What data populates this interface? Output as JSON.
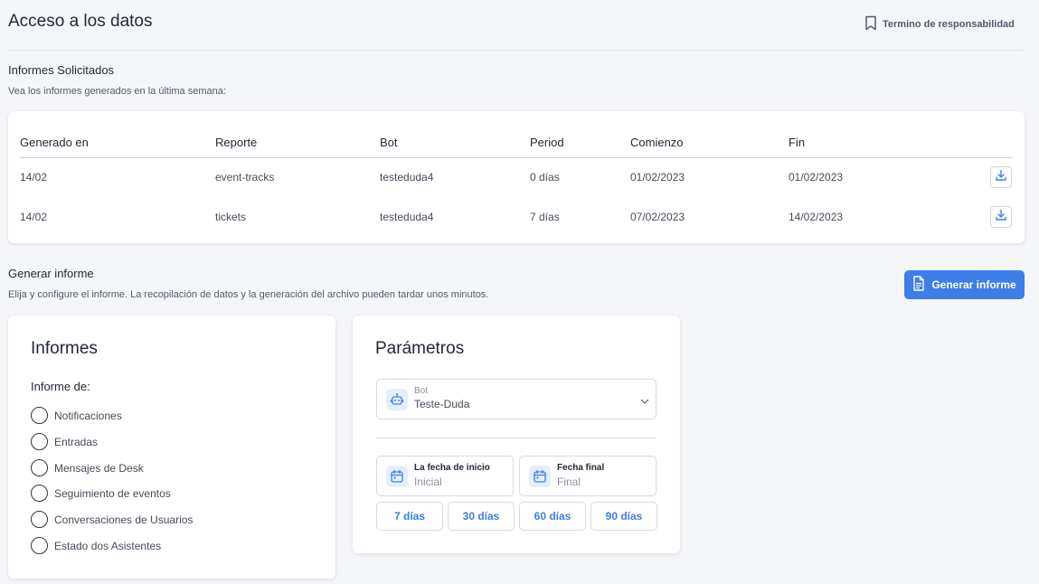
{
  "header": {
    "title": "Acceso a los datos",
    "terms_label": "Termino de responsabilidad"
  },
  "reports": {
    "title": "Informes Solicitados",
    "subtitle": "Vea los informes generados en la última semana:",
    "columns": [
      "Generado en",
      "Reporte",
      "Bot",
      "Period",
      "Comienzo",
      "Fin"
    ],
    "rows": [
      [
        "14/02",
        "event-tracks",
        "testeduda4",
        "0 días",
        "01/02/2023",
        "01/02/2023"
      ],
      [
        "14/02",
        "tickets",
        "testeduda4",
        "7 días",
        "07/02/2023",
        "14/02/2023"
      ]
    ]
  },
  "generate": {
    "title": "Generar informe",
    "subtitle": "Elija y configure el informe. La recopilación de datos y la generación del archivo pueden tardar unos minutos.",
    "button_label": "Generar informe"
  },
  "informes": {
    "title": "Informes",
    "label": "Informe de:",
    "options": [
      "Notificaciones",
      "Entradas",
      "Mensajes de Desk",
      "Seguimiento de eventos",
      "Conversaciones de Usuarios",
      "Estado dos Asistentes"
    ]
  },
  "params": {
    "title": "Parámetros",
    "bot_label": "Bot",
    "bot_value": "Teste-Duda",
    "start_label": "La fecha de inicio",
    "start_value": "Inicial",
    "end_label": "Fecha final",
    "end_value": "Final",
    "day_buttons": [
      "7 días",
      "30 días",
      "60 días",
      "90 días"
    ]
  },
  "colors": {
    "accent": "#3d7ee8",
    "background": "#f5f6fa"
  }
}
